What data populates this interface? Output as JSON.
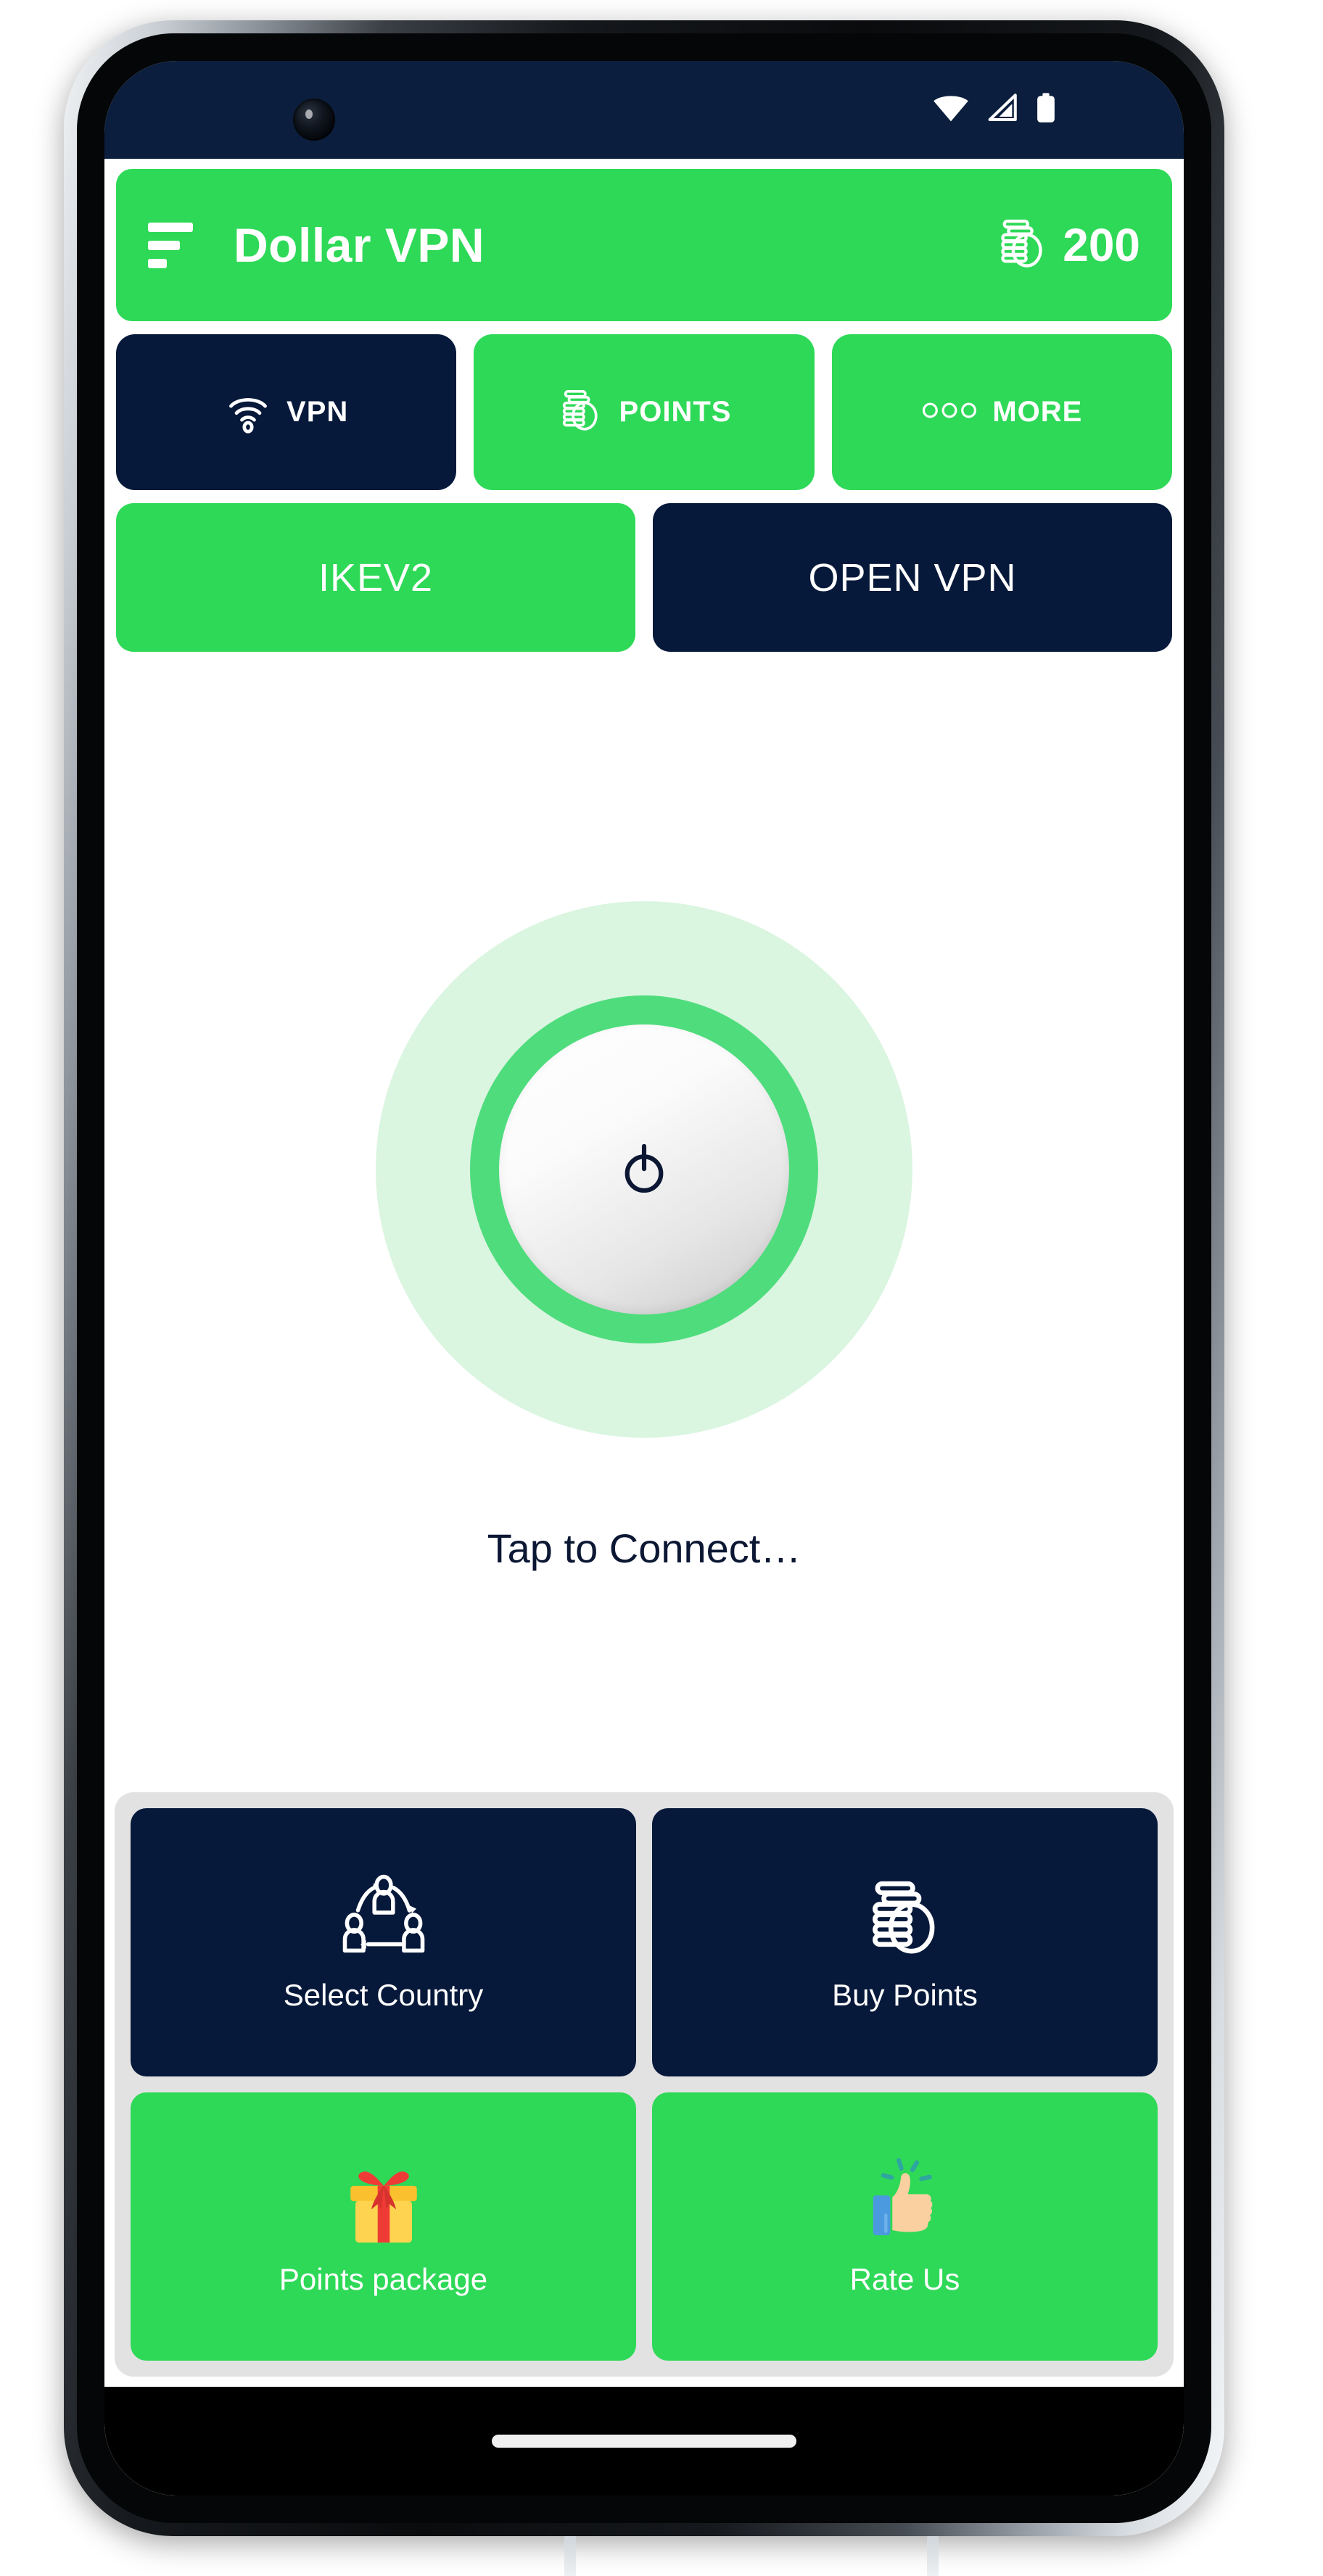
{
  "brand": {
    "green": "#2ed957",
    "navy": "#07193a",
    "status_bar_navy": "#0b1e3d",
    "panel_grey": "#e2e2e2",
    "halo_green": "#cdf2d6",
    "ring_green": "#4fdc7d"
  },
  "status_bar": {
    "icons": [
      {
        "name": "wifi-icon",
        "label": "wifi"
      },
      {
        "name": "cellular-signal-icon",
        "label": "signal"
      },
      {
        "name": "battery-icon",
        "label": "battery-full"
      }
    ]
  },
  "header": {
    "menu_icon": "hamburger-menu-icon",
    "title": "Dollar VPN",
    "points_icon": "coin-stack-icon",
    "points_value": "200"
  },
  "tabs": [
    {
      "label": "VPN",
      "icon": "wifi-icon",
      "active": true
    },
    {
      "label": "POINTS",
      "icon": "coin-stack-icon",
      "active": false
    },
    {
      "label": "MORE",
      "icon": "three-dots-icon",
      "active": false
    }
  ],
  "protocols": [
    {
      "label": "IKEV2",
      "selected": false
    },
    {
      "label": "OPEN VPN",
      "selected": true
    }
  ],
  "connect": {
    "power_icon": "power-icon",
    "status_text": "Tap to Connect…"
  },
  "bottom_grid": [
    {
      "label": "Select Country",
      "icon": "network-users-icon",
      "style": "dark"
    },
    {
      "label": "Buy Points",
      "icon": "coin-stack-icon",
      "style": "dark"
    },
    {
      "label": "Points package",
      "icon": "gift-box-icon",
      "style": "green"
    },
    {
      "label": "Rate Us",
      "icon": "thumbs-up-icon",
      "style": "green"
    }
  ],
  "nav_bar": {
    "gesture_pill": "home-gesture-pill"
  }
}
